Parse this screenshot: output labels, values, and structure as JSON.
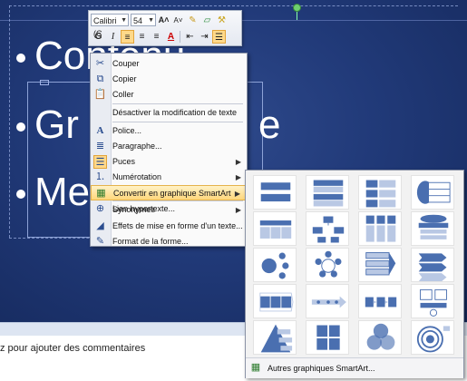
{
  "slide": {
    "bullets": [
      "Contenu",
      "Gr",
      "Me"
    ],
    "bullet2_tail": "e"
  },
  "notes": {
    "placeholder": "z pour ajouter des commentaires"
  },
  "mini_toolbar": {
    "font": "Calibri (C",
    "size": "54",
    "grow_font": "A˄",
    "shrink_font": "A˅",
    "bold": "G",
    "italic": "I",
    "font_color": "A"
  },
  "context_menu": {
    "items": [
      {
        "label": "Couper",
        "icon": "scissors-icon"
      },
      {
        "label": "Copier",
        "icon": "copy-icon"
      },
      {
        "label": "Coller",
        "icon": "paste-icon"
      },
      {
        "label": "Désactiver la modification de texte",
        "icon": ""
      },
      {
        "label": "Police...",
        "icon": "font-icon"
      },
      {
        "label": "Paragraphe...",
        "icon": "paragraph-icon"
      },
      {
        "label": "Puces",
        "icon": "bullets-icon"
      },
      {
        "label": "Numérotation",
        "icon": "numbering-icon"
      },
      {
        "label": "Convertir en graphique SmartArt",
        "icon": "smartart-icon"
      },
      {
        "label": "Lien hypertexte...",
        "icon": "hyperlink-icon"
      },
      {
        "label": "Synonymes",
        "icon": ""
      },
      {
        "label": "Effets de mise en forme d'un texte...",
        "icon": "text-effects-icon"
      },
      {
        "label": "Format de la forme...",
        "icon": "format-shape-icon"
      }
    ]
  },
  "smartart": {
    "more_label": "Autres graphiques SmartArt...",
    "accent": "#4a6fb0"
  }
}
